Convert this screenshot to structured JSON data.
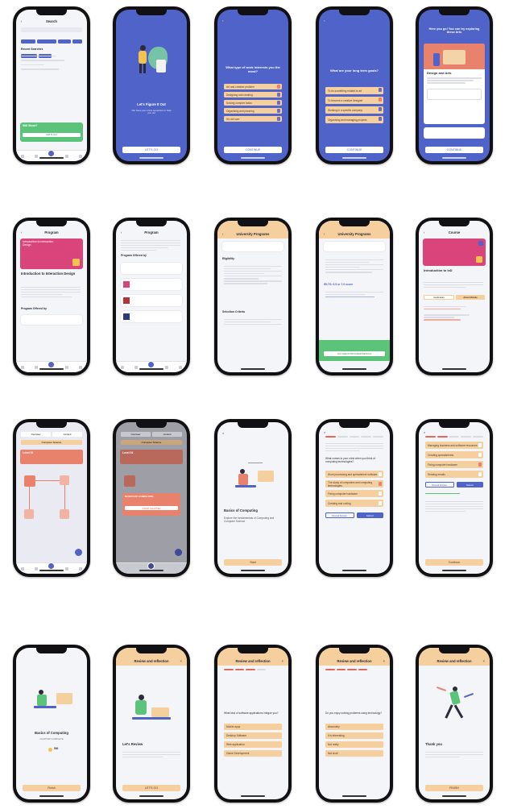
{
  "colors": {
    "primary_blue": "#4f63c9",
    "orange_option": "#f5cf9e",
    "coral": "#e9826c",
    "pink_card": "#d9457a",
    "green_banner": "#5cc47a"
  },
  "screens": {
    "search": {
      "title": "Search",
      "recent_label": "Recent Searches",
      "banner_title": "Still Stuck?",
      "banner_button": "LET'S GO"
    },
    "intro": {
      "title": "Let's Figure It Out",
      "subtitle": "We have just a few questions to help you out",
      "button": "LET'S GO"
    },
    "question1": {
      "title": "What type of work interests you the most?",
      "options": [
        "Art and creative problem",
        "Designing and creating",
        "Solving complex tasks",
        "Organising and planning",
        "It's not sure"
      ],
      "button": "CONTINUE"
    },
    "question2": {
      "title": "What are your long term goals?",
      "options": [
        "To do something related to art",
        "To become a creative designer",
        "Working in a specific company",
        "Organising and managing projects"
      ],
      "button": "CONTINUE"
    },
    "result": {
      "title": "Here you go! You can try exploring these Arts",
      "card_title": "Design and Arts",
      "button": "CONTINUE"
    },
    "program": {
      "header": "Program",
      "card_title": "Introduction to Interaction Design",
      "section": "Program Offered by"
    },
    "program_list": {
      "header": "Program",
      "section": "Program Offered by"
    },
    "university1": {
      "header": "University Programs",
      "eligibility": "Eligibility",
      "criteria": "Selection Criteria"
    },
    "university2": {
      "header": "University Programs",
      "ielts": "IELTS: 6.5 or 7.0 score",
      "button": "GO CHECK PROGRAM DETAILS"
    },
    "course": {
      "header": "Course",
      "card_title": "Introduction to IxD",
      "tab1": "Curriculum",
      "tab2": "About Module"
    },
    "path1": {
      "tab1": "Overview",
      "tab2": "Content",
      "subject": "Computer Science",
      "level": "Level 01"
    },
    "path2": {
      "tab1": "Overview",
      "tab2": "Content",
      "subject": "Computer Science",
      "level": "Level 01",
      "popup_title": "BASICS OF COMPUTING",
      "popup_button": "START CHAPTER"
    },
    "chapter": {
      "title": "Basics of Computing",
      "subtitle": "Explore the fundamentals of Computing and Computer Science",
      "button": "Start"
    },
    "quiz1": {
      "question": "What comes to your mind when you think of computing technologies?",
      "options": [
        "Word processing and spreadsheet software",
        "The study of computers and computing technologies",
        "Fixing computer hardware",
        "Creating and coding"
      ],
      "btn_left": "Reveal Answer",
      "btn_right": "Submit"
    },
    "quiz2": {
      "options": [
        "Managing business and software resources",
        "Creating spreadsheets",
        "Fixing computer hardware",
        "Sending emails"
      ],
      "btn_left": "Reveal Answer",
      "btn_right": "Submit",
      "button": "Continue"
    },
    "complete": {
      "title": "Basics of Computing",
      "subtitle": "CHAPTER COMPLETE",
      "points": "500",
      "button": "Finish"
    },
    "review_intro": {
      "header": "Review and reflection",
      "title": "Let's Review",
      "button": "LET'S GO"
    },
    "review_q1": {
      "header": "Review and reflection",
      "question": "What kind of software applications intrigue you?",
      "options": [
        "Mobile apps",
        "Desktop Software",
        "Web application",
        "Game Development"
      ]
    },
    "review_q2": {
      "header": "Review and reflection",
      "question": "Do you enjoy solving problems using technology?",
      "options": [
        "Absolutely",
        "It is interesting",
        "Not really",
        "Not at all"
      ]
    },
    "thanks": {
      "header": "Review and reflection",
      "title": "Thank you",
      "button": "FINISH"
    }
  }
}
